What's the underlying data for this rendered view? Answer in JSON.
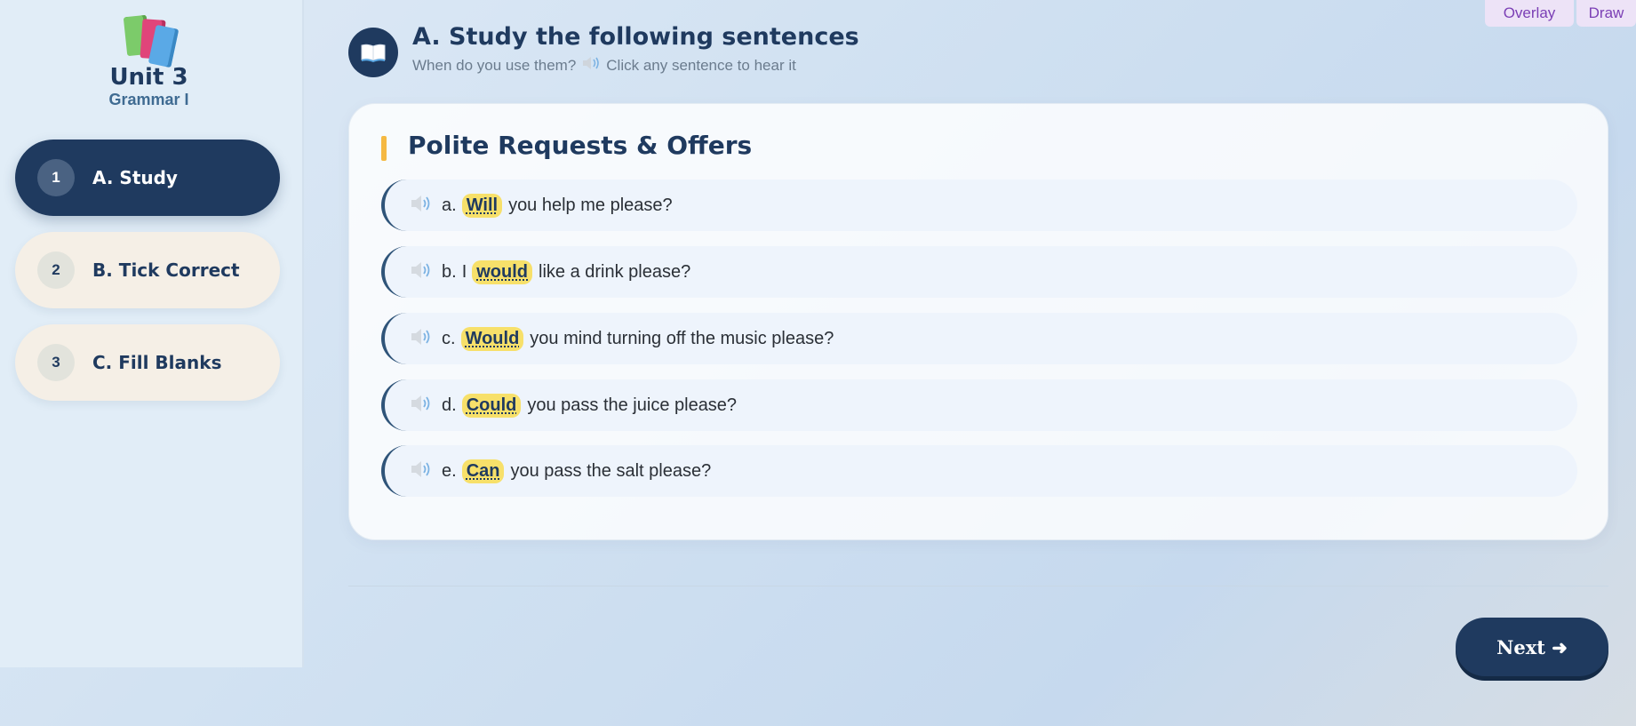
{
  "sidebar": {
    "unit": "Unit 3",
    "subtitle": "Grammar I",
    "items": [
      {
        "num": "1",
        "label": "A. Study",
        "active": true
      },
      {
        "num": "2",
        "label": "B. Tick Correct",
        "active": false
      },
      {
        "num": "3",
        "label": "C. Fill Blanks",
        "active": false
      }
    ]
  },
  "toolbar": {
    "overlay_label": "Overlay",
    "draw_label": "Draw"
  },
  "header": {
    "title": "A. Study the following sentences",
    "subtitle_before": "When do you use them?",
    "subtitle_after": "Click any sentence to hear it",
    "icon": "book-icon"
  },
  "card": {
    "title": "Polite Requests & Offers",
    "sentences": [
      {
        "letter": "a.",
        "prefix": "",
        "keyword": "Will",
        "rest": "you help me please?"
      },
      {
        "letter": "b.",
        "prefix": "I",
        "keyword": "would",
        "rest": "like a drink please?"
      },
      {
        "letter": "c.",
        "prefix": "",
        "keyword": "Would",
        "rest": "you mind turning off the music please?"
      },
      {
        "letter": "d.",
        "prefix": "",
        "keyword": "Could",
        "rest": "you pass the juice please?"
      },
      {
        "letter": "e.",
        "prefix": "",
        "keyword": "Can",
        "rest": "you pass the salt please?"
      }
    ]
  },
  "footer": {
    "next_label": "Next ➜"
  },
  "colors": {
    "primary": "#1f3a5f",
    "highlight": "#f7e06a",
    "accent_bar": "#f5b942",
    "nav_idle": "#f5efe6",
    "toolbar_text": "#7b3fb5"
  }
}
